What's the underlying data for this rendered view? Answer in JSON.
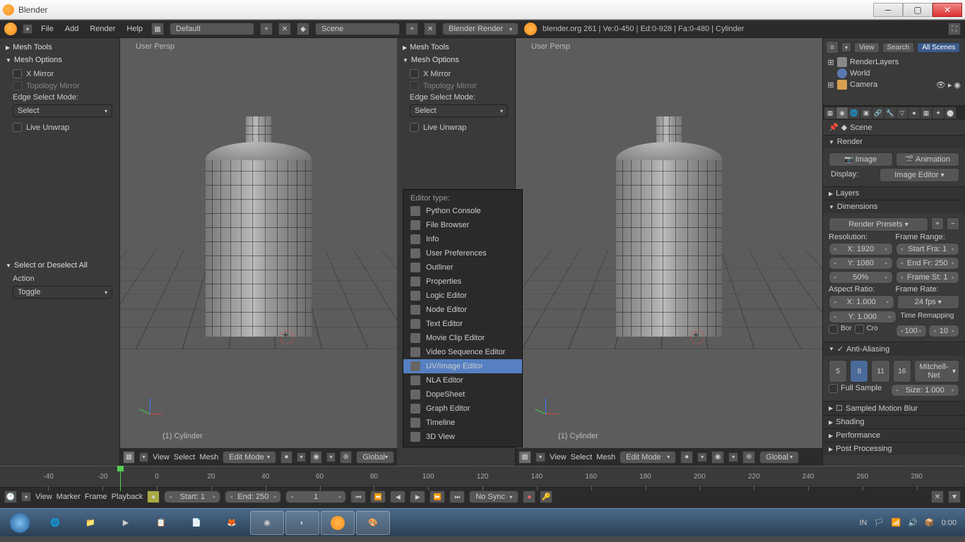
{
  "window": {
    "title": "Blender"
  },
  "topmenu": {
    "file": "File",
    "add": "Add",
    "render": "Render",
    "help": "Help",
    "layout": "Default",
    "scene": "Scene",
    "engine": "Blender Render",
    "info": "blender.org 261 | Ve:0-450 | Ed:0-928 | Fa:0-480 | Cylinder"
  },
  "toolpanel": {
    "meshtools": "Mesh Tools",
    "meshoptions": "Mesh Options",
    "xmirror": "X Mirror",
    "topomirror": "Topology Mirror",
    "edgesel": "Edge Select Mode:",
    "select": "Select",
    "liveunwrap": "Live Unwrap",
    "seldesel": "Select or Deselect All",
    "action": "Action",
    "toggle": "Toggle"
  },
  "viewport": {
    "persp": "User Persp",
    "obj": "(1) Cylinder",
    "view": "View",
    "select": "Select",
    "mesh": "Mesh",
    "editmode": "Edit Mode",
    "global": "Global"
  },
  "editortype": {
    "header": "Editor type:",
    "items": [
      "Python Console",
      "File Browser",
      "Info",
      "User Preferences",
      "Outliner",
      "Properties",
      "Logic Editor",
      "Node Editor",
      "Text Editor",
      "Movie Clip Editor",
      "Video Sequence Editor",
      "UV/Image Editor",
      "NLA Editor",
      "DopeSheet",
      "Graph Editor",
      "Timeline",
      "3D View"
    ],
    "selected": 11
  },
  "outliner": {
    "view": "View",
    "search": "Search",
    "allscenes": "All Scenes",
    "items": [
      "RenderLayers",
      "World",
      "Camera"
    ]
  },
  "props": {
    "bcrumb": "Scene",
    "render": "Render",
    "image": "Image",
    "animation": "Animation",
    "display": "Display:",
    "imageeditor": "Image Editor",
    "layers": "Layers",
    "dimensions": "Dimensions",
    "presets": "Render Presets",
    "resolution": "Resolution:",
    "framerange": "Frame Range:",
    "x": "X: 1920",
    "y": "Y: 1080",
    "pct": "50%",
    "startfra": "Start Fra: 1",
    "endfr": "End Fr: 250",
    "framest": "Frame St: 1",
    "aspect": "Aspect Ratio:",
    "framerate": "Frame Rate:",
    "ax": "X: 1.000",
    "ay": "Y: 1.000",
    "fps": "24 fps",
    "timeremap": "Time Remapping",
    "bor": "Bor",
    "cro": "Cro",
    "old": "100",
    "new": "10",
    "aa": "Anti-Aliasing",
    "s5": "5",
    "s8": "8",
    "s11": "11",
    "s16": "16",
    "filter": "Mitchell-Net",
    "fullsample": "Full Sample",
    "size": "Size: 1.000",
    "smb": "Sampled Motion Blur",
    "shading": "Shading",
    "perf": "Performance",
    "postproc": "Post Processing"
  },
  "timeline": {
    "view": "View",
    "marker": "Marker",
    "frame": "Frame",
    "playback": "Playback",
    "start": "Start: 1",
    "end": "End: 250",
    "cur": "1",
    "nosync": "No Sync",
    "ticks": [
      "-40",
      "-20",
      "0",
      "20",
      "40",
      "60",
      "80",
      "100",
      "120",
      "140",
      "160",
      "180",
      "200",
      "220",
      "240",
      "260",
      "280"
    ]
  },
  "tray": {
    "lang": "IN",
    "time": "0:00"
  }
}
